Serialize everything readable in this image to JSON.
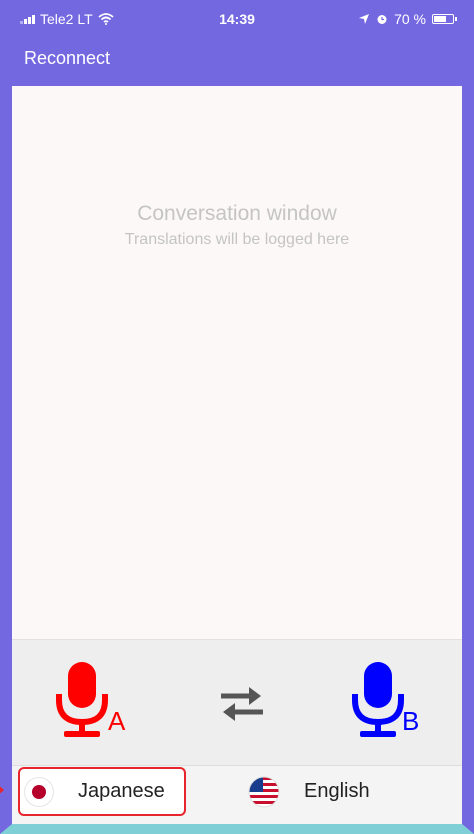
{
  "status_bar": {
    "carrier": "Tele2 LT",
    "time": "14:39",
    "battery_percent": "70 %",
    "battery_level": 0.7
  },
  "nav": {
    "reconnect_label": "Reconnect"
  },
  "conversation": {
    "title": "Conversation window",
    "subtitle": "Translations will be logged here"
  },
  "controls": {
    "mic_a_letter": "A",
    "mic_b_letter": "B",
    "mic_a_color": "#ff0000",
    "mic_b_color": "#0000ff",
    "swap_icon": "swap-arrows-icon"
  },
  "languages": {
    "source": {
      "label": "Japanese",
      "flag": "japan-flag-icon",
      "selected": true
    },
    "target": {
      "label": "English",
      "flag": "us-flag-icon",
      "selected": false
    }
  },
  "colors": {
    "header": "#7468e0",
    "highlight": "#e8242c"
  }
}
